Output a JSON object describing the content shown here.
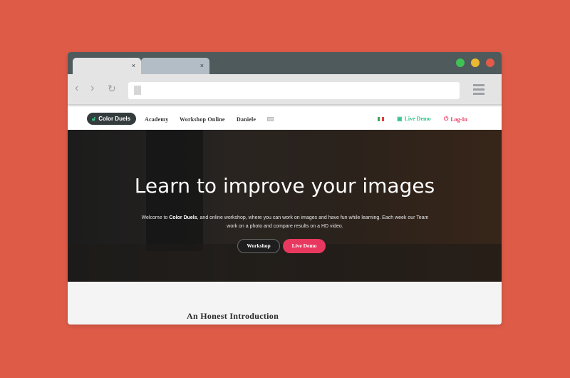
{
  "browser": {
    "tabs": [
      {
        "close": "×"
      },
      {
        "close": "×"
      }
    ],
    "window_controls": [
      {
        "name": "green",
        "color": "#3ec254"
      },
      {
        "name": "yellow",
        "color": "#ecb833"
      },
      {
        "name": "red",
        "color": "#e25a48"
      }
    ],
    "back_icon": "chevron-left-icon",
    "forward_icon": "chevron-right-icon",
    "reload_icon": "reload-icon",
    "menu_icon": "hamburger-icon",
    "address_value": ""
  },
  "site_nav": {
    "brand": "Color Duels",
    "links": [
      "Academy",
      "Workshop Online",
      "Daniele"
    ],
    "language_flag": "italian-flag",
    "live_demo": "Live Demo",
    "login": "Log-In",
    "live_demo_color": "#35c28a",
    "login_color": "#e8385f"
  },
  "hero": {
    "title": "Learn to improve your images",
    "desc_prefix": "Welcome to ",
    "desc_brand": "Color Duels",
    "desc_rest": ", and online workshop, where you can work on images and have fun while learning. Each week our Team work on a photo and compare results on a HD video.",
    "btn_workshop": "Workshop",
    "btn_live_demo": "Live Demo"
  },
  "content": {
    "section_title": "An Honest Introduction"
  }
}
